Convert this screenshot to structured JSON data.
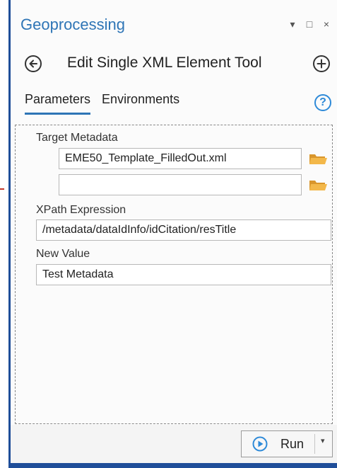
{
  "pane": {
    "title": "Geoprocessing",
    "controls": [
      "▾",
      "□",
      "×"
    ]
  },
  "tool": {
    "title": "Edit Single XML Element Tool"
  },
  "tabs": [
    {
      "label": "Parameters",
      "active": true
    },
    {
      "label": "Environments",
      "active": false
    }
  ],
  "help_glyph": "?",
  "params": {
    "target_metadata": {
      "label": "Target Metadata",
      "values": [
        "EME50_Template_FilledOut.xml",
        ""
      ]
    },
    "xpath": {
      "label": "XPath Expression",
      "value": "/metadata/dataIdInfo/idCitation/resTitle"
    },
    "new_value": {
      "label": "New Value",
      "value": "Test Metadata"
    }
  },
  "footer": {
    "run_label": "Run",
    "run_caret": "▾"
  },
  "colors": {
    "accent": "#2e75b6",
    "frame": "#1f4e99",
    "folder": "#e8a93a"
  }
}
